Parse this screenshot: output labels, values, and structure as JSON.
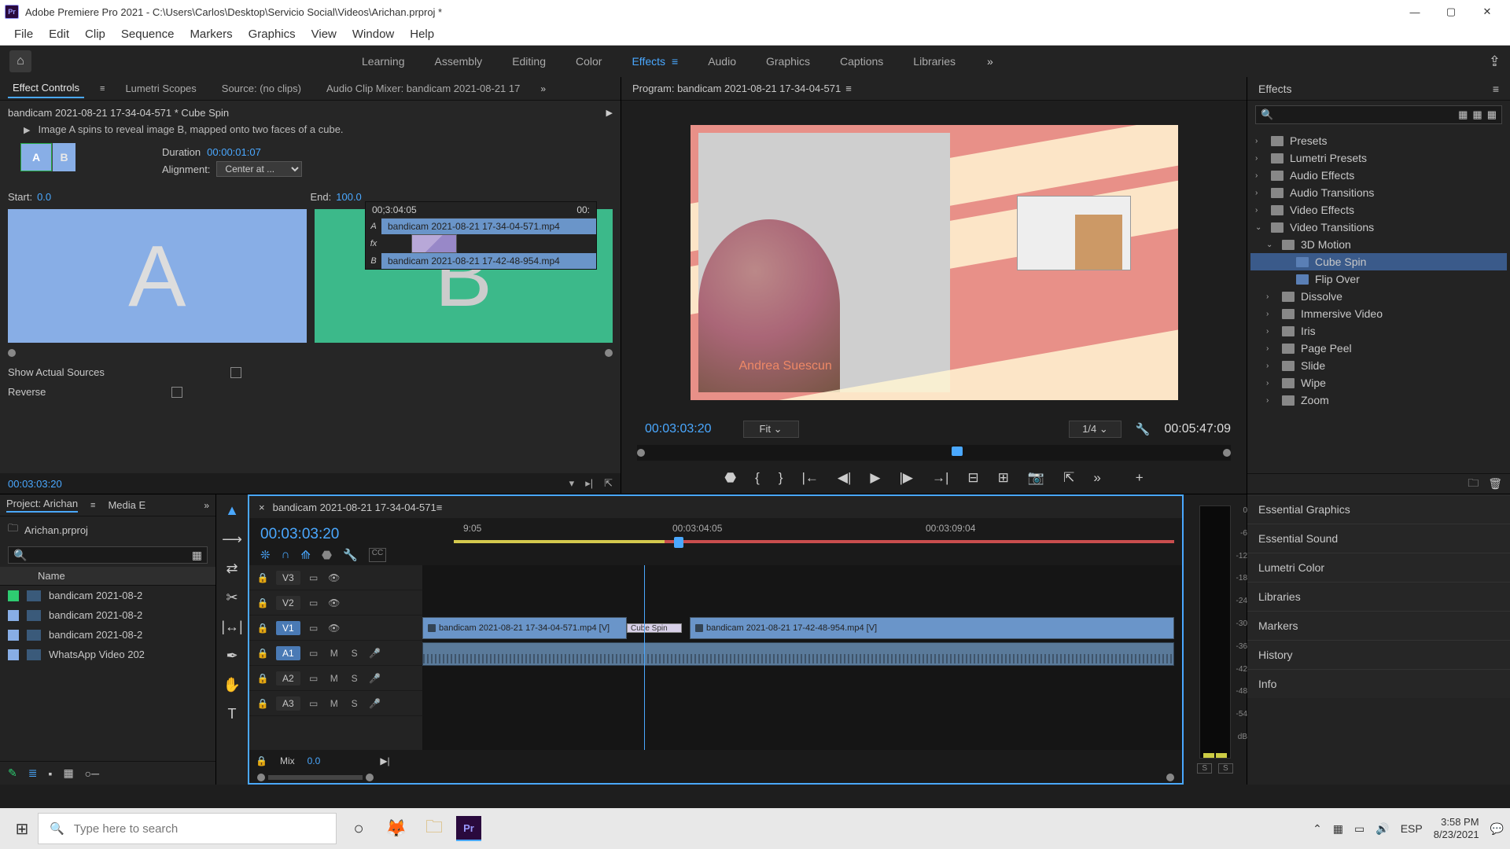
{
  "titlebar": {
    "app": "Adobe Premiere Pro 2021",
    "path": "C:\\Users\\Carlos\\Desktop\\Servicio Social\\Videos\\Arichan.prproj *"
  },
  "menu": [
    "File",
    "Edit",
    "Clip",
    "Sequence",
    "Markers",
    "Graphics",
    "View",
    "Window",
    "Help"
  ],
  "workspaces": [
    "Learning",
    "Assembly",
    "Editing",
    "Color",
    "Effects",
    "Audio",
    "Graphics",
    "Captions",
    "Libraries"
  ],
  "workspace_active": "Effects",
  "left_tabs": {
    "effect_controls": "Effect Controls",
    "lumetri": "Lumetri Scopes",
    "source": "Source: (no clips)",
    "mixer": "Audio Clip Mixer: bandicam 2021-08-21 17"
  },
  "effect_controls": {
    "title": "bandicam 2021-08-21 17-34-04-571 * Cube Spin",
    "desc": "Image A spins to reveal image B, mapped onto two faces of a cube.",
    "duration_label": "Duration",
    "duration": "00:00:01:07",
    "alignment_label": "Alignment:",
    "alignment": "Center at ...",
    "start_label": "Start:",
    "start_val": "0.0",
    "end_label": "End:",
    "end_val": "100.0",
    "show_actual": "Show Actual Sources",
    "reverse": "Reverse",
    "mini_time": "00;3:04:05",
    "mini_time_end": "00:",
    "mini_clipA": "bandicam 2021-08-21 17-34-04-571.mp4",
    "mini_clipB": "bandicam 2021-08-21 17-42-48-954.mp4",
    "mini_A": "A",
    "mini_B": "B",
    "mini_fx": "fx",
    "tc_bottom": "00:03:03:20"
  },
  "program": {
    "title": "Program: bandicam 2021-08-21 17-34-04-571",
    "person_name": "Andrea Suescun",
    "tc_left": "00:03:03:20",
    "fit": "Fit",
    "quarter": "1/4",
    "tc_right": "00:05:47:09"
  },
  "effects_panel": {
    "title": "Effects",
    "tree": [
      {
        "ind": 0,
        "arrow": "›",
        "icon": "folder",
        "label": "Presets"
      },
      {
        "ind": 0,
        "arrow": "›",
        "icon": "folder",
        "label": "Lumetri Presets"
      },
      {
        "ind": 0,
        "arrow": "›",
        "icon": "folder",
        "label": "Audio Effects"
      },
      {
        "ind": 0,
        "arrow": "›",
        "icon": "folder",
        "label": "Audio Transitions"
      },
      {
        "ind": 0,
        "arrow": "›",
        "icon": "folder",
        "label": "Video Effects"
      },
      {
        "ind": 0,
        "arrow": "⌄",
        "icon": "folder",
        "label": "Video Transitions"
      },
      {
        "ind": 1,
        "arrow": "⌄",
        "icon": "folder",
        "label": "3D Motion"
      },
      {
        "ind": 2,
        "arrow": "",
        "icon": "fx",
        "label": "Cube Spin",
        "sel": true
      },
      {
        "ind": 2,
        "arrow": "",
        "icon": "fx",
        "label": "Flip Over"
      },
      {
        "ind": 1,
        "arrow": "›",
        "icon": "folder",
        "label": "Dissolve"
      },
      {
        "ind": 1,
        "arrow": "›",
        "icon": "folder",
        "label": "Immersive Video"
      },
      {
        "ind": 1,
        "arrow": "›",
        "icon": "folder",
        "label": "Iris"
      },
      {
        "ind": 1,
        "arrow": "›",
        "icon": "folder",
        "label": "Page Peel"
      },
      {
        "ind": 1,
        "arrow": "›",
        "icon": "folder",
        "label": "Slide"
      },
      {
        "ind": 1,
        "arrow": "›",
        "icon": "folder",
        "label": "Wipe"
      },
      {
        "ind": 1,
        "arrow": "›",
        "icon": "folder",
        "label": "Zoom"
      }
    ]
  },
  "side_panels": [
    "Essential Graphics",
    "Essential Sound",
    "Lumetri Color",
    "Libraries",
    "Markers",
    "History",
    "Info"
  ],
  "project": {
    "tab1": "Project: Arichan",
    "tab2": "Media E",
    "file": "Arichan.prproj",
    "header": "Name",
    "items": [
      {
        "color": "#2ecc71",
        "name": "bandicam 2021-08-2"
      },
      {
        "color": "#88aee6",
        "name": "bandicam 2021-08-2"
      },
      {
        "color": "#88aee6",
        "name": "bandicam 2021-08-2"
      },
      {
        "color": "#88aee6",
        "name": "WhatsApp Video 202"
      }
    ]
  },
  "timeline": {
    "seq": "bandicam 2021-08-21 17-34-04-571",
    "tc": "00:03:03:20",
    "ticks": [
      "9:05",
      "00:03:04:05",
      "00:03:09:04"
    ],
    "tracks": [
      "V3",
      "V2",
      "V1",
      "A1",
      "A2",
      "A3"
    ],
    "mix": "Mix",
    "mix_val": "0.0",
    "clip1": "bandicam 2021-08-21 17-34-04-571.mp4 [V]",
    "clip2": "bandicam 2021-08-21 17-42-48-954.mp4 [V]",
    "trans": "Cube Spin",
    "M": "M",
    "S": "S"
  },
  "meters": {
    "labels": [
      "0",
      "-6",
      "-12",
      "-18",
      "-24",
      "-30",
      "-36",
      "-42",
      "-48",
      "-54",
      "dB"
    ],
    "S": "S"
  },
  "taskbar": {
    "search": "Type here to search",
    "lang": "ESP",
    "time": "3:58 PM",
    "date": "8/23/2021"
  }
}
